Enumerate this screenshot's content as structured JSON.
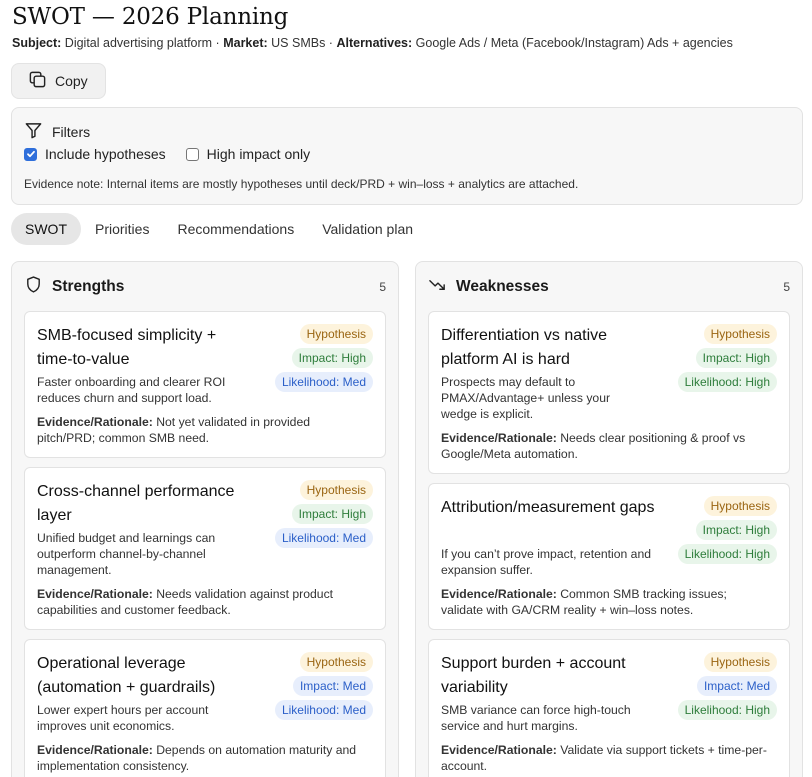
{
  "page": {
    "title": "SWOT — 2026 Planning",
    "subject_label": "Subject:",
    "subject_value": "Digital advertising platform ·",
    "market_label": "Market:",
    "market_value": "US SMBs ·",
    "alternatives_label": "Alternatives:",
    "alternatives_value": "Google Ads / Meta (Facebook/Instagram) Ads + agencies"
  },
  "toolbar": {
    "copy_label": "Copy",
    "copy_icon": "copy-icon"
  },
  "filters": {
    "heading": "Filters",
    "icon": "filter-icon",
    "include_hypotheses_label": "Include hypotheses",
    "include_hypotheses_checked": true,
    "high_impact_label": "High impact only",
    "high_impact_checked": false,
    "evidence_note": "Evidence note: Internal items are mostly hypotheses until deck/PRD + win–loss + analytics are attached."
  },
  "tabs": [
    {
      "label": "SWOT",
      "active": true
    },
    {
      "label": "Priorities",
      "active": false
    },
    {
      "label": "Recommendations",
      "active": false
    },
    {
      "label": "Validation plan",
      "active": false
    }
  ],
  "colors": {
    "accent": "#2f6fdb",
    "hypothesis": "#9a6512",
    "high": "#2e7d3b",
    "med": "#2b5fc8"
  },
  "strengths": {
    "title": "Strengths",
    "icon": "shield-icon",
    "count": "5",
    "cards": [
      {
        "title": "SMB-focused simplicity + time-to-value",
        "status": "Hypothesis",
        "impact": "Impact: High",
        "likelihood": "Likelihood: Med",
        "body": "Faster onboarding and clearer ROI reduces churn and support load.",
        "evidence_label": "Evidence/Rationale:",
        "evidence": "Not yet validated in provided pitch/PRD; common SMB need."
      },
      {
        "title": "Cross-channel performance layer",
        "status": "Hypothesis",
        "impact": "Impact: High",
        "likelihood": "Likelihood: Med",
        "body": "Unified budget and learnings can outperform channel-by-channel management.",
        "evidence_label": "Evidence/Rationale:",
        "evidence": "Needs validation against product capabilities and customer feedback."
      },
      {
        "title": "Operational leverage (automation + guardrails)",
        "status": "Hypothesis",
        "impact": "Impact: Med",
        "likelihood": "Likelihood: Med",
        "body": "Lower expert hours per account improves unit economics.",
        "evidence_label": "Evidence/Rationale:",
        "evidence": "Depends on automation maturity and implementation consistency."
      }
    ]
  },
  "weaknesses": {
    "title": "Weaknesses",
    "icon": "trending-down-icon",
    "count": "5",
    "cards": [
      {
        "title": "Differentiation vs native platform AI is hard",
        "status": "Hypothesis",
        "impact": "Impact: High",
        "likelihood": "Likelihood: High",
        "body": "Prospects may default to PMAX/Advantage+ unless your wedge is explicit.",
        "evidence_label": "Evidence/Rationale:",
        "evidence": "Needs clear positioning & proof vs Google/Meta automation."
      },
      {
        "title": "Attribution/measurement gaps",
        "status": "Hypothesis",
        "impact": "Impact: High",
        "likelihood": "Likelihood: High",
        "body": "If you can’t prove impact, retention and expansion suffer.",
        "evidence_label": "Evidence/Rationale:",
        "evidence": "Common SMB tracking issues; validate with GA/CRM reality + win–loss notes."
      },
      {
        "title": "Support burden + account variability",
        "status": "Hypothesis",
        "impact": "Impact: Med",
        "likelihood": "Likelihood: High",
        "body": "SMB variance can force high-touch service and hurt margins.",
        "evidence_label": "Evidence/Rationale:",
        "evidence": "Validate via support tickets + time-per-account."
      }
    ]
  }
}
